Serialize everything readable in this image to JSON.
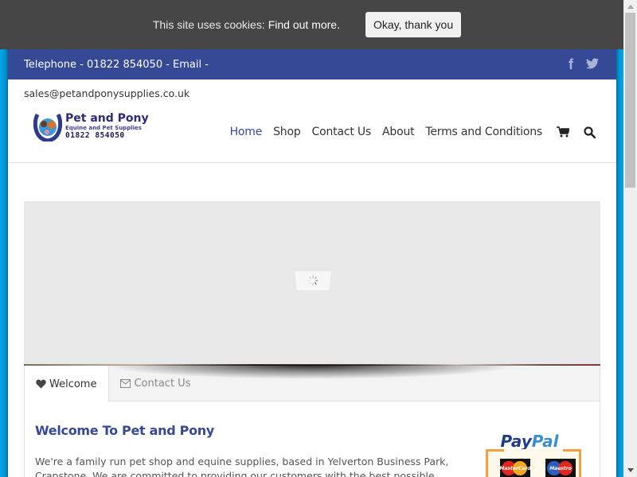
{
  "cookie_bar": {
    "message": "This site uses cookies:",
    "link_label": "Find out more.",
    "accept_label": "Okay, thank you"
  },
  "topbar": {
    "contact_text": "Telephone - 01822 854050 - Email -",
    "social": [
      {
        "name": "facebook",
        "icon": "facebook-icon",
        "glyph": "f"
      },
      {
        "name": "twitter",
        "icon": "twitter-icon",
        "glyph": "t"
      }
    ]
  },
  "header": {
    "email": "sales@petandponysupplies.co.uk",
    "logo": {
      "title": "Pet and Pony",
      "subtitle": "Equine and Pet Supplies",
      "phone": "01822  854050"
    },
    "nav": [
      {
        "label": "Home",
        "active": true
      },
      {
        "label": "Shop",
        "active": false
      },
      {
        "label": "Contact Us",
        "active": false
      },
      {
        "label": "About",
        "active": false
      },
      {
        "label": "Terms and Conditions",
        "active": false
      }
    ],
    "icons": [
      "cart-icon",
      "search-icon"
    ]
  },
  "slider": {
    "state": "loading"
  },
  "tabs": [
    {
      "label": "Welcome",
      "icon": "heart-icon",
      "active": true
    },
    {
      "label": "Contact Us",
      "icon": "envelope-icon",
      "active": false
    }
  ],
  "content": {
    "heading": "Welcome To Pet and Pony",
    "body": "We're a family run pet shop and equine supplies, based in Yelverton Business Park, Crapstone. We are committed to providing our customers with the best possible"
  },
  "payment": {
    "brand": "PayPal",
    "brand_part1": "Pay",
    "brand_part2": "Pal",
    "cards": [
      "MasterCard",
      "Maestro"
    ]
  },
  "colors": {
    "brand_blue": "#364996",
    "cookie_bg": "#464646",
    "page_bg": "#00a2e6",
    "paypal_orange": "#f5a040"
  }
}
